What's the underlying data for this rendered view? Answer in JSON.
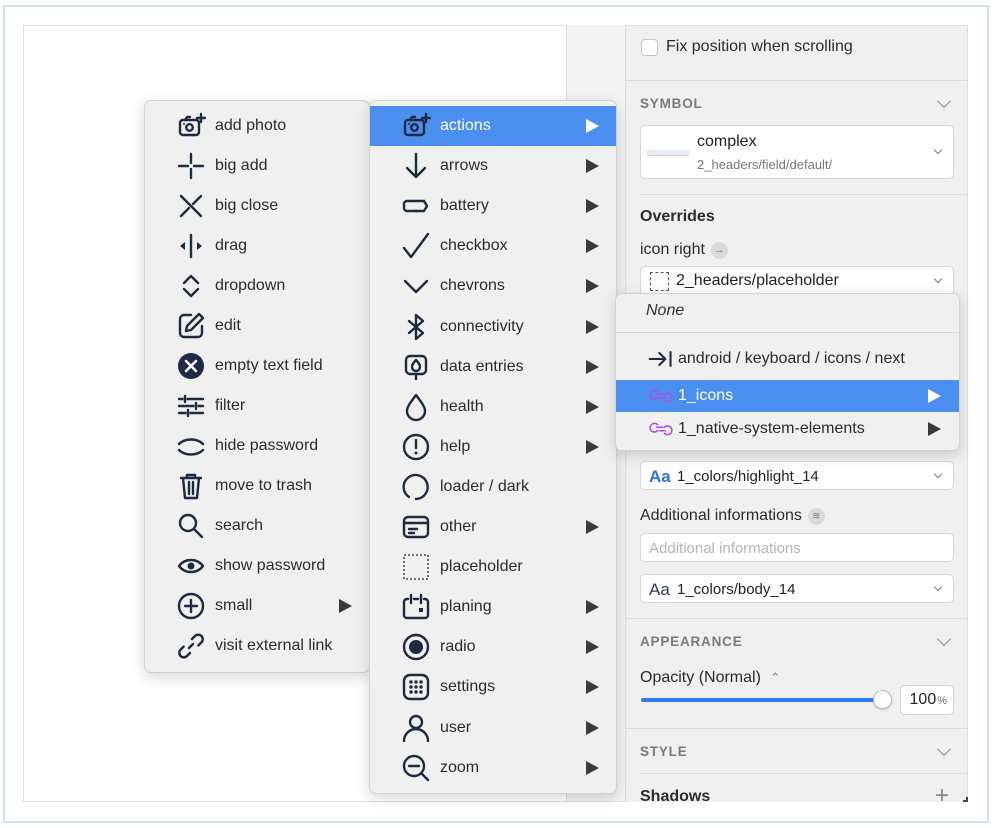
{
  "inspector": {
    "fix_position_label": "Fix position when scrolling",
    "fix_position_checked": false,
    "symbol": {
      "section_title": "SYMBOL",
      "name": "complex",
      "path": "2_headers/field/default/"
    },
    "overrides": {
      "title": "Overrides",
      "icon_right_label": "icon right",
      "icon_right_value": "2_headers/placeholder",
      "text_style_1": "1_colors/highlight_14",
      "additional_label": "Additional informations",
      "additional_placeholder": "Additional informations",
      "text_style_2": "1_colors/body_14",
      "aa_glyph": "Aa"
    },
    "appearance": {
      "section_title": "APPEARANCE",
      "opacity_label": "Opacity (Normal)",
      "opacity_value": "100",
      "opacity_unit": "%",
      "opacity_fraction": 1.0
    },
    "style": {
      "section_title": "STYLE",
      "shadows_label": "Shadows"
    }
  },
  "menu_level1": [
    {
      "label": "add photo",
      "icon": "add-photo-icon",
      "submenu": false
    },
    {
      "label": "big add",
      "icon": "big-add-icon",
      "submenu": false
    },
    {
      "label": "big close",
      "icon": "big-close-icon",
      "submenu": false
    },
    {
      "label": "drag",
      "icon": "drag-icon",
      "submenu": false
    },
    {
      "label": "dropdown",
      "icon": "dropdown-icon",
      "submenu": false
    },
    {
      "label": "edit",
      "icon": "edit-icon",
      "submenu": false
    },
    {
      "label": "empty text field",
      "icon": "clear-field-icon",
      "submenu": false
    },
    {
      "label": "filter",
      "icon": "filter-icon",
      "submenu": false
    },
    {
      "label": "hide password",
      "icon": "hide-password-icon",
      "submenu": false
    },
    {
      "label": "move to trash",
      "icon": "trash-icon",
      "submenu": false
    },
    {
      "label": "search",
      "icon": "search-icon",
      "submenu": false
    },
    {
      "label": "show password",
      "icon": "eye-icon",
      "submenu": false
    },
    {
      "label": "small",
      "icon": "plus-circle-icon",
      "submenu": true
    },
    {
      "label": "visit external link",
      "icon": "link-icon",
      "submenu": false
    }
  ],
  "menu_level2": [
    {
      "label": "actions",
      "icon": "add-photo-icon",
      "submenu": true,
      "selected": true
    },
    {
      "label": "arrows",
      "icon": "arrow-down-icon",
      "submenu": true
    },
    {
      "label": "battery",
      "icon": "battery-icon",
      "submenu": true
    },
    {
      "label": "checkbox",
      "icon": "checkmark-icon",
      "submenu": true
    },
    {
      "label": "chevrons",
      "icon": "chevron-down-icon",
      "submenu": true
    },
    {
      "label": "connectivity",
      "icon": "bluetooth-icon",
      "submenu": true
    },
    {
      "label": "data entries",
      "icon": "data-entry-icon",
      "submenu": true
    },
    {
      "label": "health",
      "icon": "drop-icon",
      "submenu": true
    },
    {
      "label": "help",
      "icon": "alert-circle-icon",
      "submenu": true
    },
    {
      "label": "loader / dark",
      "icon": "loader-icon",
      "submenu": false
    },
    {
      "label": "other",
      "icon": "card-icon",
      "submenu": true
    },
    {
      "label": "placeholder",
      "icon": "placeholder-icon",
      "submenu": false
    },
    {
      "label": "planing",
      "icon": "calendar-icon",
      "submenu": true
    },
    {
      "label": "radio",
      "icon": "radio-icon",
      "submenu": true
    },
    {
      "label": "settings",
      "icon": "grid-icon",
      "submenu": true
    },
    {
      "label": "user",
      "icon": "user-icon",
      "submenu": true
    },
    {
      "label": "zoom",
      "icon": "zoom-out-icon",
      "submenu": true
    }
  ],
  "menu_level3": {
    "none_label": "None",
    "items": [
      {
        "label": "android / keyboard / icons / next",
        "icon": "next-arrow-icon",
        "submenu": false
      },
      {
        "label": "1_icons",
        "icon": "library-link-icon",
        "submenu": true,
        "selected": true
      },
      {
        "label": "1_native-system-elements",
        "icon": "library-link-icon",
        "submenu": true
      }
    ]
  },
  "colors": {
    "selection": "#4a8ff0",
    "slider": "#2f7cf0",
    "library_icon": "#b44ae0",
    "icon_ink": "#1d2a44"
  }
}
